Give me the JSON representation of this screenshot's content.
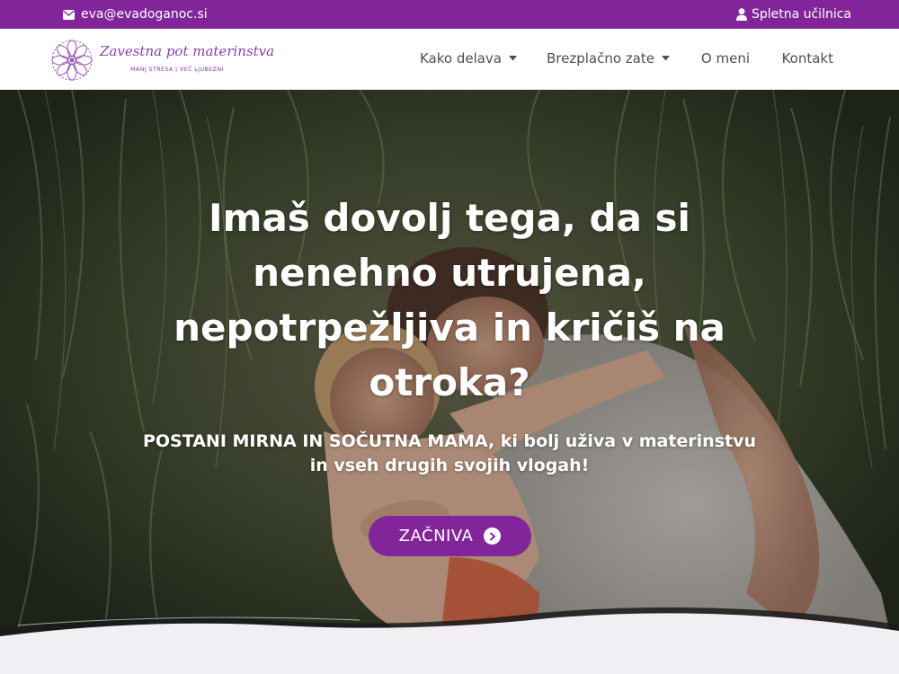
{
  "topbar": {
    "email": "eva@evadoganoc.si",
    "email_icon": "envelope-icon",
    "login_label": "Spletna učilnica",
    "login_icon": "user-icon"
  },
  "logo": {
    "script_text": "Zavestna pot materinstva",
    "tagline": "MANJ STRESA | VEČ LJUBEZNI",
    "icon": "mandala-icon"
  },
  "nav": {
    "items": [
      {
        "label": "Kako delava",
        "dropdown": true
      },
      {
        "label": "Brezplačno zate",
        "dropdown": true
      },
      {
        "label": "O meni",
        "dropdown": false
      },
      {
        "label": "Kontakt",
        "dropdown": false
      }
    ]
  },
  "hero": {
    "title_lines": [
      "Imaš dovolj tega, da si",
      "nenehno utrujena,",
      "nepotrpežljiva in kričiš na",
      "otroka?"
    ],
    "subtitle_lines": [
      "POSTANI MIRNA IN SOČUTNA MAMA, ki bolj uživa v materinstvu",
      "in vseh drugih svojih vlogah!"
    ],
    "cta_label": "ZAČNIVA",
    "cta_icon": "arrow-circle-right-icon"
  },
  "colors": {
    "brand": "#82259a",
    "header_bg": "#ffffff",
    "nav_text": "#4e4e4e",
    "section_bg": "#f1eff4"
  }
}
